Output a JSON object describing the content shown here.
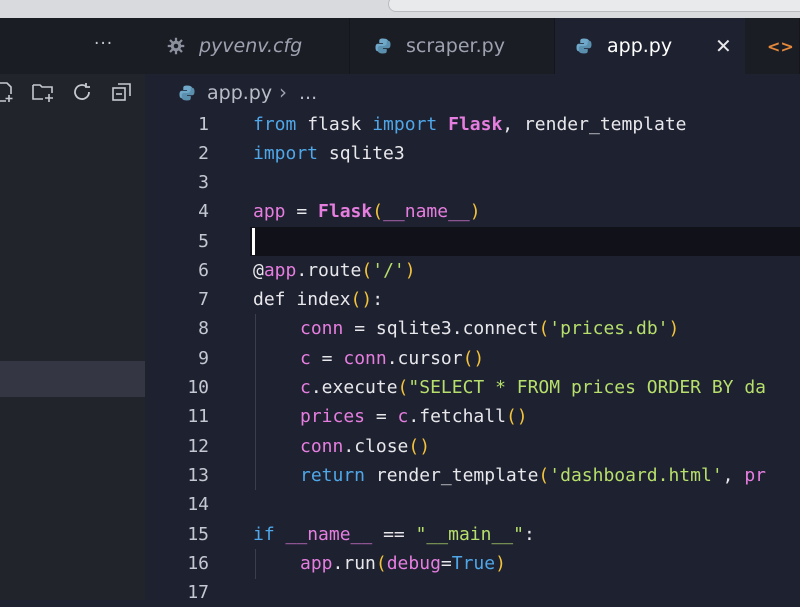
{
  "sidebar": {
    "more_label": "···",
    "icons": [
      "new-file-icon",
      "new-folder-icon",
      "refresh-icon",
      "collapse-all-icon"
    ]
  },
  "tabs": [
    {
      "label": "pyvenv.cfg",
      "icon": "gear-icon"
    },
    {
      "label": "scraper.py",
      "icon": "python-icon"
    },
    {
      "label": "app.py",
      "icon": "python-icon",
      "active": true
    },
    {
      "label": "",
      "icon": "html-tag-icon"
    }
  ],
  "tab_close_label": "✕",
  "tag_icon_glyph": "<>",
  "breadcrumb": {
    "file": "app.py",
    "sep": "›",
    "rest": "..."
  },
  "line_numbers": [
    "1",
    "2",
    "3",
    "4",
    "5",
    "6",
    "7",
    "8",
    "9",
    "10",
    "11",
    "12",
    "13",
    "14",
    "15",
    "16",
    "17"
  ],
  "code": {
    "l1": {
      "kw1": "from",
      "mod": " flask ",
      "kw2": "import",
      "sp": " ",
      "cls": "Flask",
      "rest": ", render_template"
    },
    "l2": {
      "kw": "import",
      "rest": " sqlite3"
    },
    "l4": {
      "var": "app",
      "eq": " = ",
      "cls": "Flask",
      "p1": "(",
      "arg": "__name__",
      "p2": ")"
    },
    "l6": {
      "at": "@",
      "var": "app",
      "rest": ".route",
      "p1": "(",
      "str": "'/'",
      "p2": ")"
    },
    "l7": {
      "kw": "def",
      "name": " index",
      "p": "()",
      "colon": ":"
    },
    "l8": {
      "var": "conn",
      "eq": " = ",
      "fn": "sqlite3.connect",
      "p1": "(",
      "str": "'prices.db'",
      "p2": ")"
    },
    "l9": {
      "var": "c",
      "eq": " = ",
      "var2": "conn",
      "fn": ".cursor",
      "p": "()"
    },
    "l10": {
      "var": "c",
      "fn": ".execute",
      "p1": "(",
      "str": "\"SELECT * FROM prices ORDER BY da"
    },
    "l11": {
      "var": "prices",
      "eq": " = ",
      "var2": "c",
      "fn": ".fetchall",
      "p": "()"
    },
    "l12": {
      "var": "conn",
      "fn": ".close",
      "p": "()"
    },
    "l13": {
      "kw": "return",
      "fn": " render_template",
      "p1": "(",
      "str": "'dashboard.html'",
      "rest": ", ",
      "var": "pr"
    },
    "l15": {
      "kw": "if",
      "sp": " ",
      "var": "__name__",
      "op": " == ",
      "str": "\"__main__\"",
      "colon": ":"
    },
    "l16": {
      "var": "app",
      "fn": ".run",
      "p1": "(",
      "arg": "debug",
      "eq": "=",
      "val": "True",
      "p2": ")"
    }
  }
}
